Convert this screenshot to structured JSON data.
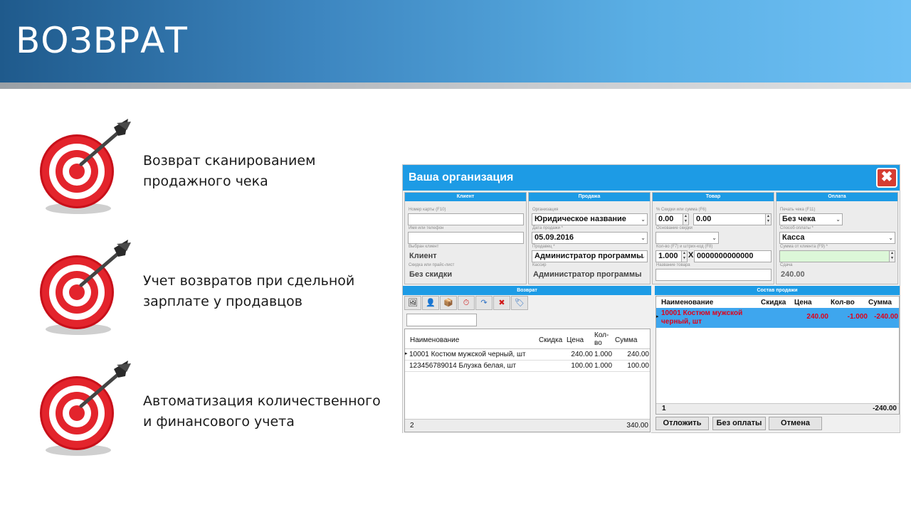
{
  "slide": {
    "title": "ВОЗВРАТ",
    "bullets": [
      {
        "line1": "Возврат сканированием",
        "line2": "продажного чека"
      },
      {
        "line1": "Учет возвратов при сдельной",
        "line2": "зарплате у продавцов"
      },
      {
        "line1": "Автоматизация количественного",
        "line2": "и финансового учета"
      }
    ]
  },
  "app": {
    "title": "Ваша организация",
    "close_label": "✖",
    "client": {
      "header": "Клиент",
      "card_label": "Номер карты (F10)",
      "name_label": "Имя или телефон",
      "selected_label": "Выбран клиент",
      "selected_value": "Клиент",
      "discount_label": "Скидка или прайс-лист",
      "discount_value": "Без скидки"
    },
    "sale": {
      "header": "Продажа",
      "org_label": "Организация",
      "org_value": "Юридическое название",
      "date_label": "Дата продажи *",
      "date_value": "05.09.2016",
      "seller_label": "Продавец *",
      "seller_value": "Администратор программы",
      "cashier_label": "Кассир",
      "cashier_value": "Администратор программы"
    },
    "goods": {
      "header": "Товар",
      "discount_label": "% Скидки или сумма (F6)",
      "discount_pct": "0.00",
      "discount_sum": "0.00",
      "reason_label": "Основание скидки",
      "qty_label": "Кол-во (F7) и штрих-код (F8)",
      "qty_value": "1.000",
      "x_sign": "X",
      "barcode_value": "0000000000000",
      "name_label": "Название товара"
    },
    "payment": {
      "header": "Оплата",
      "print_label": "Печать чека (F11)",
      "print_value": "Без чека",
      "method_label": "Способ оплаты *",
      "method_value": "Касса",
      "client_sum_label": "Сумма от клиента (F9) *",
      "change_label": "Сдача",
      "change_value": "240.00"
    },
    "return_panel": {
      "header": "Возврат",
      "toolbar_icons": [
        "image-icon",
        "user-icon",
        "box-icon",
        "clock-icon",
        "return-arrow-icon",
        "delete-icon",
        "tag-icon"
      ],
      "toolbar_glyphs": [
        "🖼",
        "👤",
        "📦",
        "⏱",
        "↷",
        "✖",
        "🏷"
      ],
      "columns": [
        "Наименование",
        "Скидка",
        "Цена",
        "Кол-во",
        "Сумма"
      ],
      "rows": [
        {
          "name": "10001 Костюм мужской черный, шт",
          "discount": "",
          "price": "240.00",
          "qty": "1.000",
          "sum": "240.00"
        },
        {
          "name": "123456789014 Блузка белая, шт",
          "discount": "",
          "price": "100.00",
          "qty": "1.000",
          "sum": "100.00"
        }
      ],
      "footer_count": "2",
      "footer_sum": "340.00"
    },
    "sale_contents": {
      "header": "Состав продажи",
      "columns": [
        "Наименование",
        "Скидка",
        "Цена",
        "Кол-во",
        "Сумма"
      ],
      "rows": [
        {
          "name": "10001 Костюм мужской черный, шт",
          "discount": "",
          "price": "240.00",
          "qty": "-1.000",
          "sum": "-240.00"
        }
      ],
      "footer_count": "1",
      "footer_sum": "-240.00"
    },
    "buttons": {
      "postpone": "Отложить",
      "no_payment": "Без оплаты",
      "cancel": "Отмена"
    },
    "colors": {
      "accent": "#1d9be5",
      "selected_row": "#3ea6ee",
      "selected_text": "#e0001a",
      "client_sum_bg": "#dcf7d8"
    }
  }
}
